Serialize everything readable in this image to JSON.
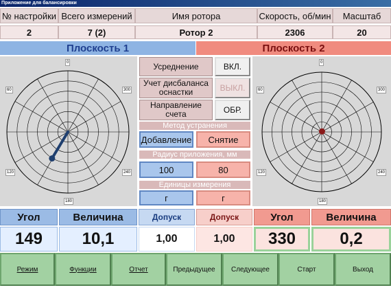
{
  "window": {
    "title": "Приложение для балансировки"
  },
  "header": {
    "labels": [
      "№ настройки",
      "Всего измерений",
      "Имя ротора",
      "Скорость, об/мин",
      "Масштаб"
    ],
    "values": [
      "2",
      "7 (2)",
      "Ротор 2",
      "2306",
      "20"
    ]
  },
  "planes": {
    "plane1": "Плоскость 1",
    "plane2": "Плоскость 2"
  },
  "polar_ticks": {
    "top": "0",
    "left": "60",
    "right": "300",
    "bottom_left": "120",
    "bottom_right": "240",
    "bottom": "180"
  },
  "settings": {
    "averaging_label": "Усреднение",
    "averaging_value": "ВКЛ.",
    "fixture_label": "Учет дисбаланса оснастки",
    "fixture_value": "ВЫКЛ.",
    "direction_label": "Направление счета",
    "direction_value": "ОБР.",
    "method_label": "Метод устранения",
    "method_add": "Добавление",
    "method_remove": "Снятие",
    "radius_label": "Радиус приложения, мм",
    "radius_1": "100",
    "radius_2": "80",
    "units_label": "Единицы измерения",
    "units_1": "г",
    "units_2": "г"
  },
  "results": {
    "angle_label": "Угол",
    "magnitude_label": "Величина",
    "tolerance_label": "Допуск",
    "plane1": {
      "angle": "149",
      "magnitude": "10,1",
      "tolerance": "1,00"
    },
    "plane2": {
      "angle": "330",
      "magnitude": "0,2",
      "tolerance": "1,00"
    }
  },
  "buttons": [
    "Режим",
    "Функции",
    "Отчет",
    "Предыдущее",
    "Следующее",
    "Старт",
    "Выход"
  ],
  "vectors": {
    "plane1": {
      "angle_deg": 149,
      "magnitude": 10.1,
      "scale": 20
    },
    "plane2": {
      "angle_deg": 330,
      "magnitude": 0.2,
      "scale": 20
    }
  },
  "colors": {
    "plane1": "#8eb4e3",
    "plane2": "#f08b7f",
    "vector1": "#1f3f6f",
    "vector2": "#8b1a1a",
    "button": "#a2d1a2"
  }
}
